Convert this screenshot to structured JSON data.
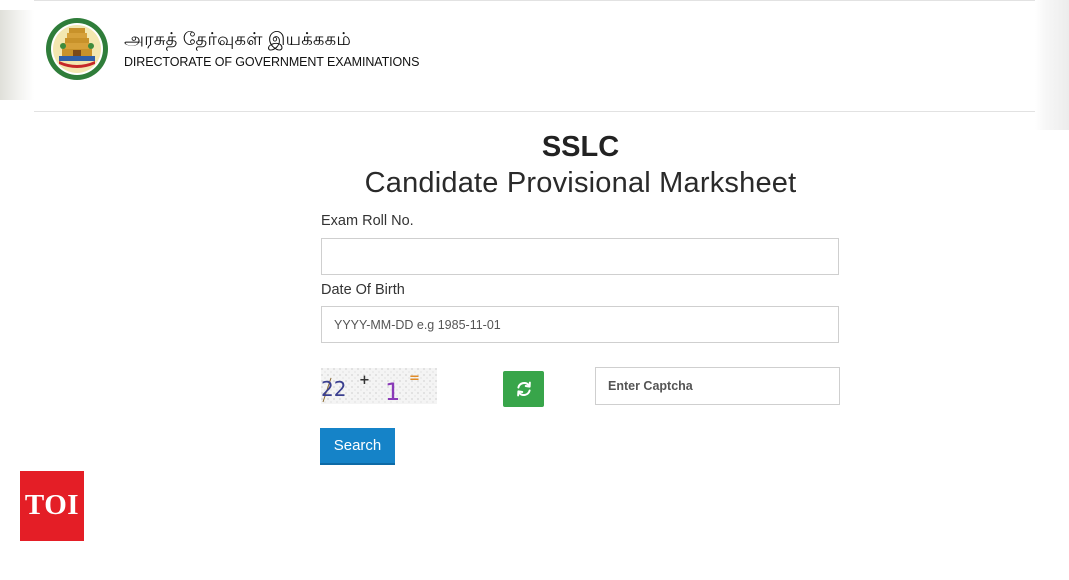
{
  "header": {
    "tamil_title": "அரசுத் தேர்வுகள் இயக்ககம்",
    "dept_title": "DIRECTORATE OF GOVERNMENT EXAMINATIONS",
    "emblem_icon": "tamil-nadu-emblem-icon"
  },
  "form": {
    "title_line1": "SSLC",
    "title_line2": "Candidate Provisional Marksheet",
    "roll_label": "Exam Roll No.",
    "roll_value": "",
    "roll_placeholder": "",
    "dob_label": "Date Of Birth",
    "dob_value": "",
    "dob_placeholder": "YYYY-MM-DD e.g 1985-11-01",
    "captcha": {
      "num1": "22",
      "operator": "+",
      "num2": "1",
      "equals": "=",
      "refresh_icon": "refresh-icon",
      "input_placeholder": "Enter Captcha",
      "input_value": ""
    },
    "search_label": "Search"
  },
  "watermark": {
    "logo_text": "TOI"
  },
  "colors": {
    "search_button": "#1583c8",
    "refresh_button": "#38a54a",
    "toi_red": "#e41e26"
  }
}
